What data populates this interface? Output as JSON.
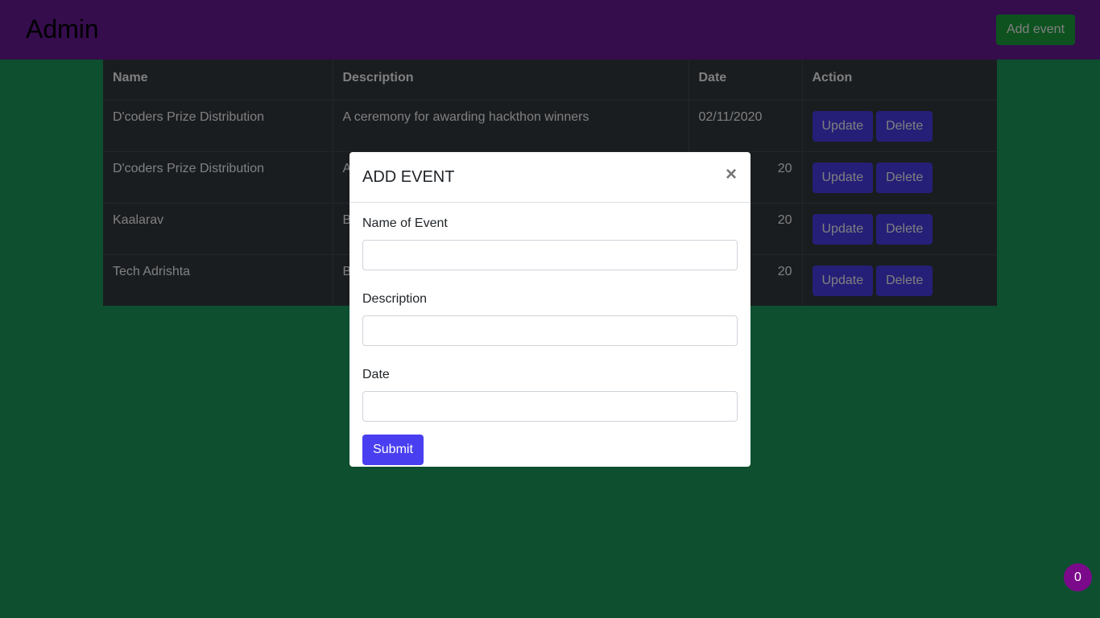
{
  "navbar": {
    "brand": "Admin",
    "add_event_label": "Add event"
  },
  "table": {
    "headers": [
      "Name",
      "Description",
      "Date",
      "Action"
    ],
    "rows": [
      {
        "name": "D'coders Prize Distribution",
        "description": "A ceremony for awarding hackthon winners",
        "date": "02/11/2020"
      },
      {
        "name": "D'coders Prize Distribution",
        "description": "A",
        "date": "20"
      },
      {
        "name": "Kaalarav",
        "description": "B",
        "date": "20"
      },
      {
        "name": "Tech Adrishta",
        "description": "B",
        "date": "20"
      }
    ],
    "update_label": "Update",
    "delete_label": "Delete"
  },
  "modal": {
    "title": "ADD EVENT",
    "close_glyph": "×",
    "fields": [
      {
        "label": "Name of Event",
        "value": ""
      },
      {
        "label": "Description",
        "value": ""
      },
      {
        "label": "Date",
        "value": ""
      }
    ],
    "submit_label": "Submit"
  },
  "badge": {
    "count": "0"
  },
  "colors": {
    "navbar": "#6a1b9a",
    "background": "#1a9e5e",
    "table": "#343a40",
    "primary_button": "#4a3ff0",
    "add_event_button": "#1aa53f",
    "badge": "#7b0a8a"
  }
}
